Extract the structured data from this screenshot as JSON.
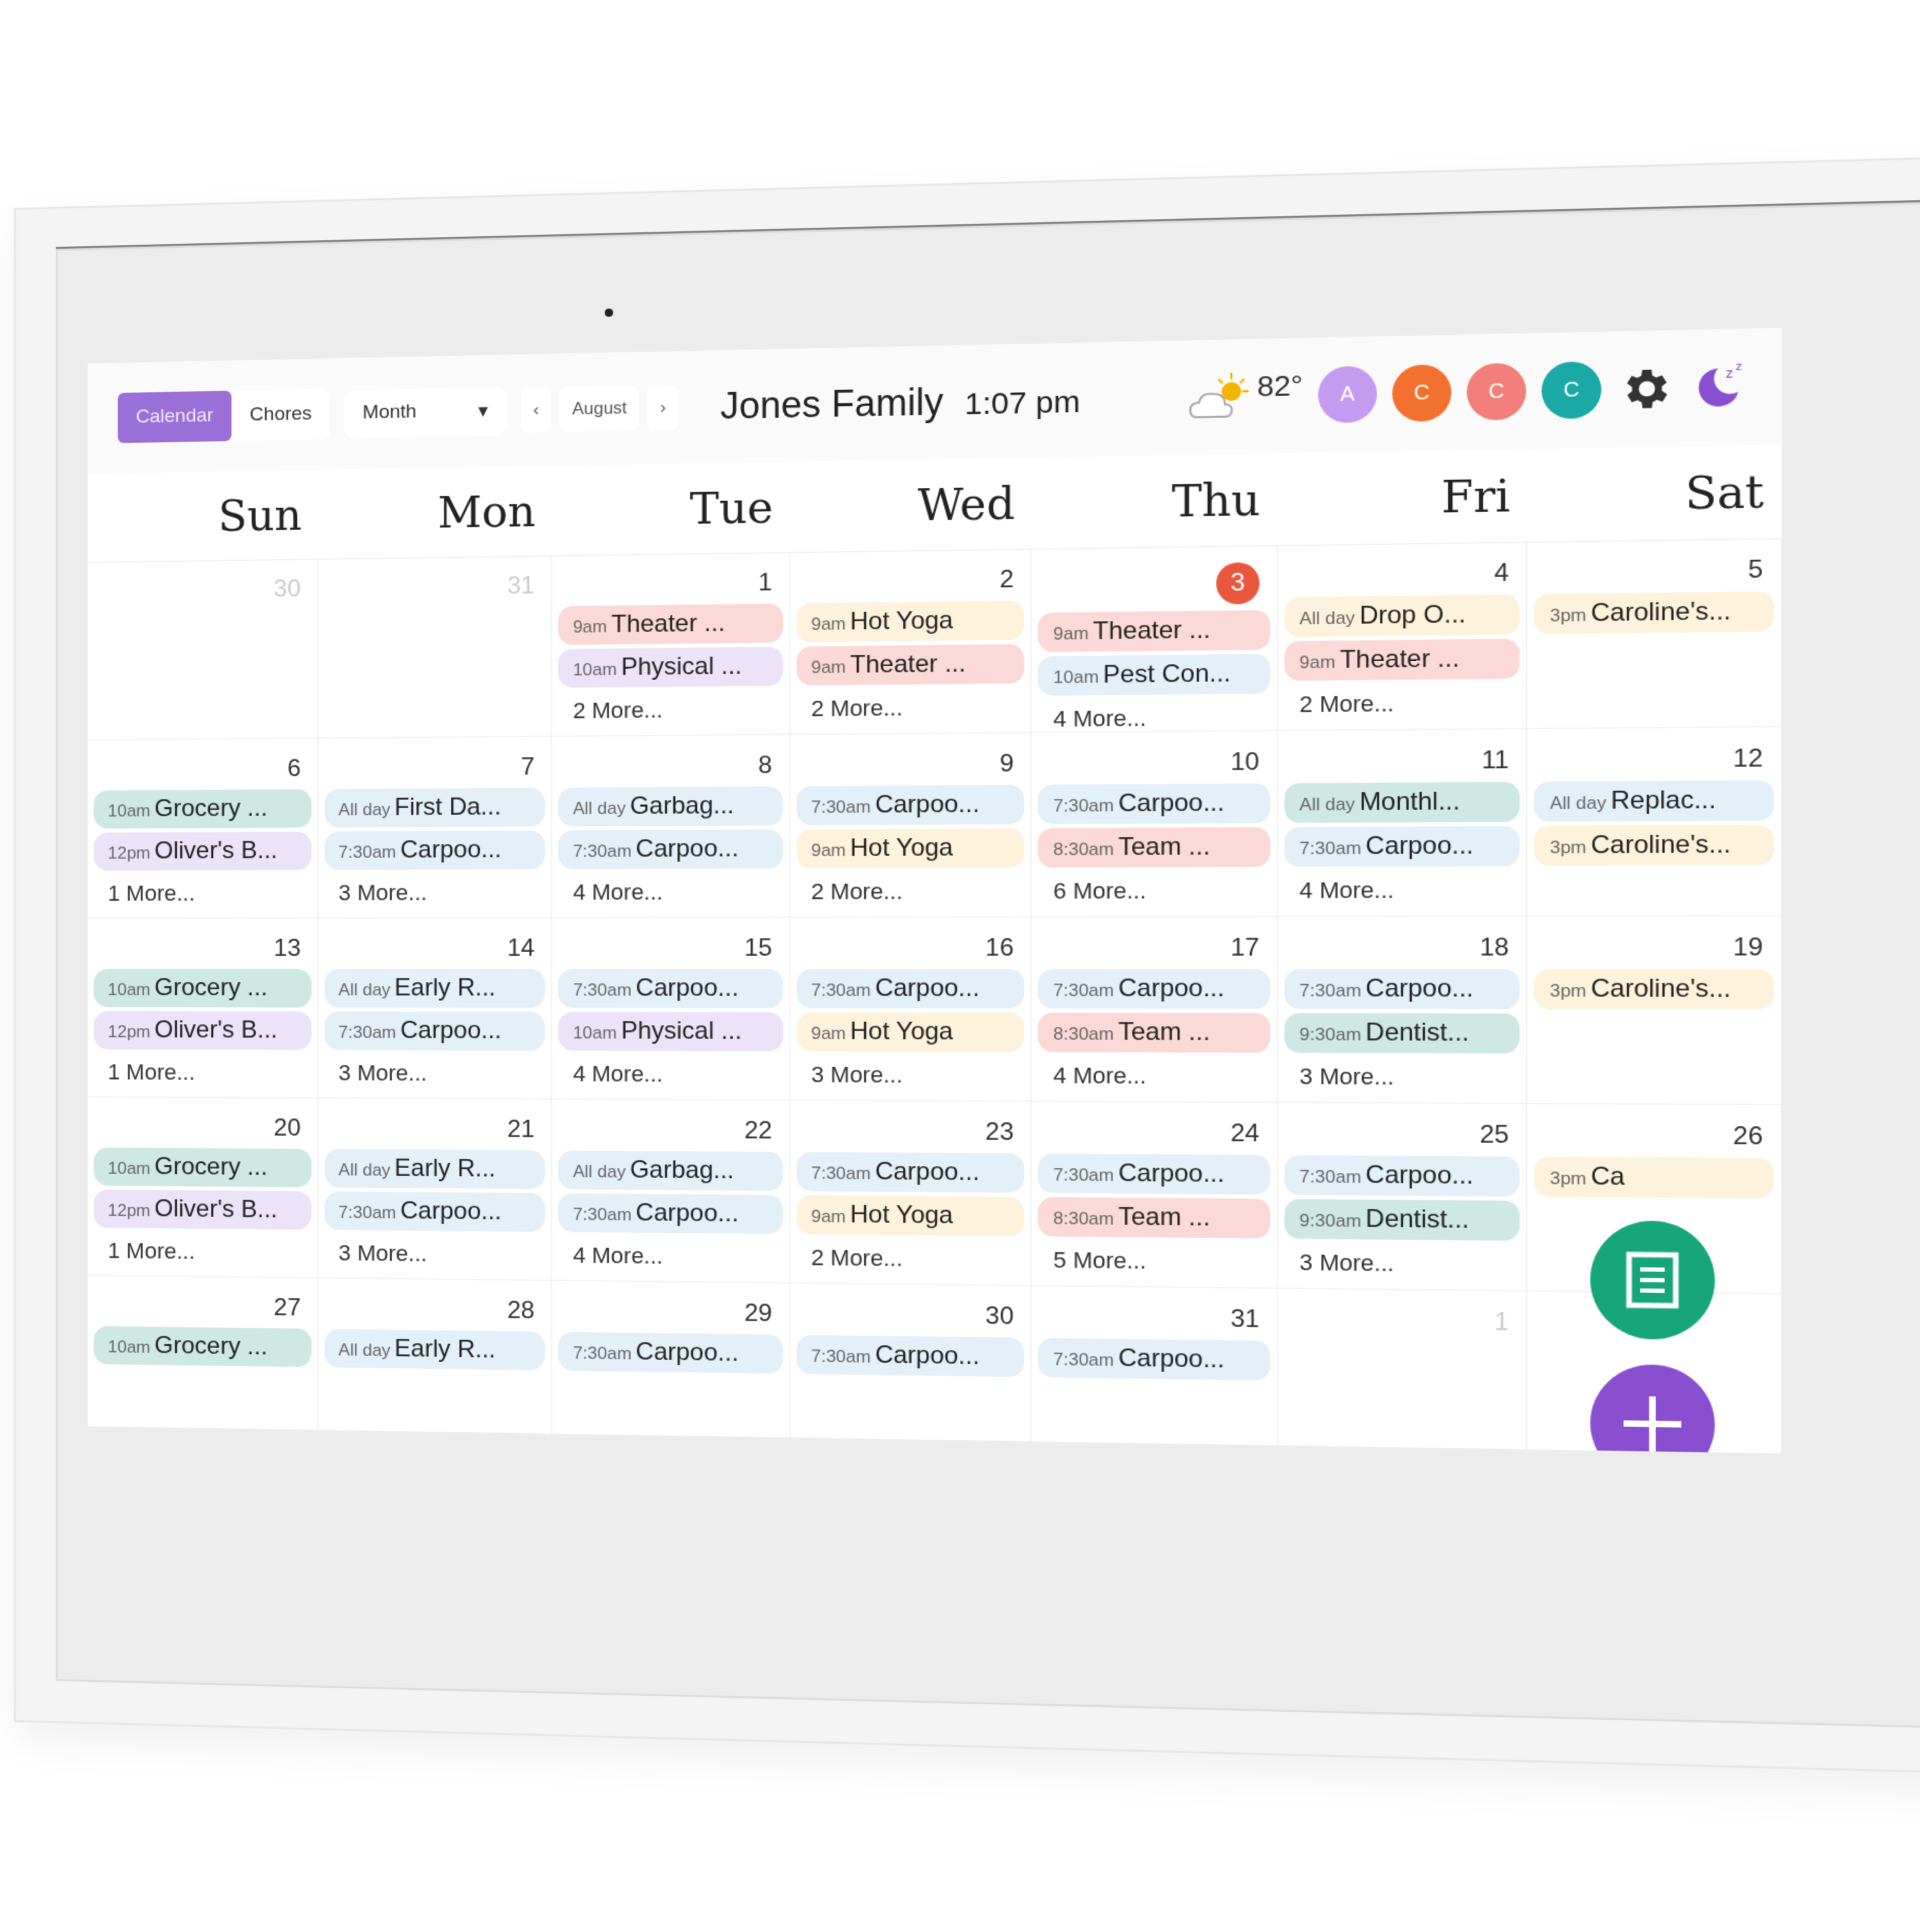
{
  "topbar": {
    "tabs": [
      {
        "label": "Calendar",
        "active": true
      },
      {
        "label": "Chores",
        "active": false
      }
    ],
    "view_select": "Month",
    "month": "August",
    "prev_icon": "chevron-left-icon",
    "next_icon": "chevron-right-icon",
    "family_name": "Jones Family",
    "time": "1:07 pm",
    "weather": {
      "icon": "partly-sunny-icon",
      "temp": "82°"
    },
    "profiles": [
      {
        "initial": "A",
        "color": "#c39cf0"
      },
      {
        "initial": "C",
        "color": "#f2712e"
      },
      {
        "initial": "C",
        "color": "#f27f79"
      },
      {
        "initial": "C",
        "color": "#1aa9a5"
      }
    ],
    "settings_icon": "gear-icon",
    "sleep_icon": "moon-sleep-icon"
  },
  "colors": {
    "accent": "#9b6fd8",
    "today": "#e9573f",
    "pink": "#fbd9d6",
    "lavender": "#ece3f8",
    "yellow": "#fdf3dc",
    "blue": "#e3f0f8",
    "teal": "#cfe8e4",
    "fab_green": "#17a57a",
    "fab_purple": "#8a4fd0"
  },
  "weekdays": [
    "Sun",
    "Mon",
    "Tue",
    "Wed",
    "Thu",
    "Fri",
    "Sat"
  ],
  "weeks": [
    [
      {
        "day": "30",
        "muted": true,
        "events": [],
        "more": ""
      },
      {
        "day": "31",
        "muted": true,
        "events": [],
        "more": ""
      },
      {
        "day": "1",
        "events": [
          {
            "time": "9am",
            "title": "Theater ...",
            "color": "pink"
          },
          {
            "time": "10am",
            "title": "Physical ...",
            "color": "lavender"
          }
        ],
        "more": "2 More..."
      },
      {
        "day": "2",
        "events": [
          {
            "time": "9am",
            "title": "Hot Yoga",
            "color": "yellow"
          },
          {
            "time": "9am",
            "title": "Theater ...",
            "color": "pink"
          }
        ],
        "more": "2 More..."
      },
      {
        "day": "3",
        "today": true,
        "events": [
          {
            "time": "9am",
            "title": "Theater ...",
            "color": "pink"
          },
          {
            "time": "10am",
            "title": "Pest Con...",
            "color": "blue"
          }
        ],
        "more": "4 More..."
      },
      {
        "day": "4",
        "events": [
          {
            "time": "All day",
            "title": "Drop O...",
            "color": "yellow"
          },
          {
            "time": "9am",
            "title": "Theater ...",
            "color": "pink"
          }
        ],
        "more": "2 More..."
      },
      {
        "day": "5",
        "events": [
          {
            "time": "3pm",
            "title": "Caroline's...",
            "color": "yellow"
          }
        ],
        "more": ""
      }
    ],
    [
      {
        "day": "6",
        "events": [
          {
            "time": "10am",
            "title": "Grocery ...",
            "color": "teal"
          },
          {
            "time": "12pm",
            "title": "Oliver's B...",
            "color": "lavender"
          }
        ],
        "more": "1 More..."
      },
      {
        "day": "7",
        "events": [
          {
            "time": "All day",
            "title": "First Da...",
            "color": "blue"
          },
          {
            "time": "7:30am",
            "title": "Carpoo...",
            "color": "blue"
          }
        ],
        "more": "3 More..."
      },
      {
        "day": "8",
        "events": [
          {
            "time": "All day",
            "title": "Garbag...",
            "color": "blue"
          },
          {
            "time": "7:30am",
            "title": "Carpoo...",
            "color": "blue"
          }
        ],
        "more": "4 More..."
      },
      {
        "day": "9",
        "events": [
          {
            "time": "7:30am",
            "title": "Carpoo...",
            "color": "blue"
          },
          {
            "time": "9am",
            "title": "Hot Yoga",
            "color": "yellow"
          }
        ],
        "more": "2 More..."
      },
      {
        "day": "10",
        "events": [
          {
            "time": "7:30am",
            "title": "Carpoo...",
            "color": "blue"
          },
          {
            "time": "8:30am",
            "title": "Team ...",
            "color": "pink"
          }
        ],
        "more": "6 More..."
      },
      {
        "day": "11",
        "events": [
          {
            "time": "All day",
            "title": "Monthl...",
            "color": "teal"
          },
          {
            "time": "7:30am",
            "title": "Carpoo...",
            "color": "blue"
          }
        ],
        "more": "4 More..."
      },
      {
        "day": "12",
        "events": [
          {
            "time": "All day",
            "title": "Replac...",
            "color": "blue"
          },
          {
            "time": "3pm",
            "title": "Caroline's...",
            "color": "yellow"
          }
        ],
        "more": ""
      }
    ],
    [
      {
        "day": "13",
        "events": [
          {
            "time": "10am",
            "title": "Grocery ...",
            "color": "teal"
          },
          {
            "time": "12pm",
            "title": "Oliver's B...",
            "color": "lavender"
          }
        ],
        "more": "1 More..."
      },
      {
        "day": "14",
        "events": [
          {
            "time": "All day",
            "title": "Early R...",
            "color": "blue"
          },
          {
            "time": "7:30am",
            "title": "Carpoo...",
            "color": "blue"
          }
        ],
        "more": "3 More..."
      },
      {
        "day": "15",
        "events": [
          {
            "time": "7:30am",
            "title": "Carpoo...",
            "color": "blue"
          },
          {
            "time": "10am",
            "title": "Physical ...",
            "color": "lavender"
          }
        ],
        "more": "4 More..."
      },
      {
        "day": "16",
        "events": [
          {
            "time": "7:30am",
            "title": "Carpoo...",
            "color": "blue"
          },
          {
            "time": "9am",
            "title": "Hot Yoga",
            "color": "yellow"
          }
        ],
        "more": "3 More..."
      },
      {
        "day": "17",
        "events": [
          {
            "time": "7:30am",
            "title": "Carpoo...",
            "color": "blue"
          },
          {
            "time": "8:30am",
            "title": "Team ...",
            "color": "pink"
          }
        ],
        "more": "4 More..."
      },
      {
        "day": "18",
        "events": [
          {
            "time": "7:30am",
            "title": "Carpoo...",
            "color": "blue"
          },
          {
            "time": "9:30am",
            "title": "Dentist...",
            "color": "teal"
          }
        ],
        "more": "3 More..."
      },
      {
        "day": "19",
        "events": [
          {
            "time": "3pm",
            "title": "Caroline's...",
            "color": "yellow"
          }
        ],
        "more": ""
      }
    ],
    [
      {
        "day": "20",
        "events": [
          {
            "time": "10am",
            "title": "Grocery ...",
            "color": "teal"
          },
          {
            "time": "12pm",
            "title": "Oliver's B...",
            "color": "lavender"
          }
        ],
        "more": "1 More..."
      },
      {
        "day": "21",
        "events": [
          {
            "time": "All day",
            "title": "Early R...",
            "color": "blue"
          },
          {
            "time": "7:30am",
            "title": "Carpoo...",
            "color": "blue"
          }
        ],
        "more": "3 More..."
      },
      {
        "day": "22",
        "events": [
          {
            "time": "All day",
            "title": "Garbag...",
            "color": "blue"
          },
          {
            "time": "7:30am",
            "title": "Carpoo...",
            "color": "blue"
          }
        ],
        "more": "4 More..."
      },
      {
        "day": "23",
        "events": [
          {
            "time": "7:30am",
            "title": "Carpoo...",
            "color": "blue"
          },
          {
            "time": "9am",
            "title": "Hot Yoga",
            "color": "yellow"
          }
        ],
        "more": "2 More..."
      },
      {
        "day": "24",
        "events": [
          {
            "time": "7:30am",
            "title": "Carpoo...",
            "color": "blue"
          },
          {
            "time": "8:30am",
            "title": "Team ...",
            "color": "pink"
          }
        ],
        "more": "5 More..."
      },
      {
        "day": "25",
        "events": [
          {
            "time": "7:30am",
            "title": "Carpoo...",
            "color": "blue"
          },
          {
            "time": "9:30am",
            "title": "Dentist...",
            "color": "teal"
          }
        ],
        "more": "3 More..."
      },
      {
        "day": "26",
        "events": [
          {
            "time": "3pm",
            "title": "Ca",
            "color": "yellow"
          }
        ],
        "more": ""
      }
    ],
    [
      {
        "day": "27",
        "events": [
          {
            "time": "10am",
            "title": "Grocery ...",
            "color": "teal"
          }
        ],
        "more": ""
      },
      {
        "day": "28",
        "events": [
          {
            "time": "All day",
            "title": "Early R...",
            "color": "blue"
          }
        ],
        "more": ""
      },
      {
        "day": "29",
        "events": [
          {
            "time": "7:30am",
            "title": "Carpoo...",
            "color": "blue"
          }
        ],
        "more": ""
      },
      {
        "day": "30",
        "events": [
          {
            "time": "7:30am",
            "title": "Carpoo...",
            "color": "blue"
          }
        ],
        "more": ""
      },
      {
        "day": "31",
        "events": [
          {
            "time": "7:30am",
            "title": "Carpoo...",
            "color": "blue"
          }
        ],
        "more": ""
      },
      {
        "day": "1",
        "muted": true,
        "events": [],
        "more": ""
      },
      {
        "day": "",
        "muted": true,
        "events": [],
        "more": ""
      }
    ]
  ],
  "fabs": {
    "list_icon": "list-document-icon",
    "add_icon": "plus-icon"
  }
}
